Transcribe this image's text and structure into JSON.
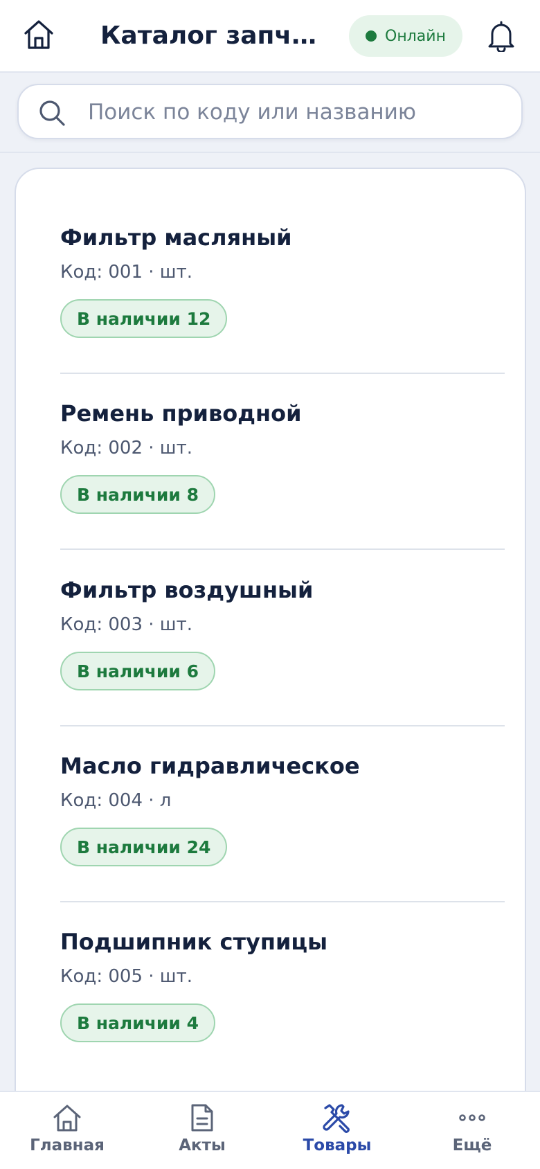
{
  "header": {
    "title": "Каталог запчастей",
    "status": "Онлайн"
  },
  "search": {
    "placeholder": "Поиск по коду или названию",
    "value": ""
  },
  "items": [
    {
      "name": "Фильтр масляный",
      "code": "Код: 001 · шт.",
      "stock": "В наличии 12"
    },
    {
      "name": "Ремень приводной",
      "code": "Код: 002 · шт.",
      "stock": "В наличии 8"
    },
    {
      "name": "Фильтр воздушный",
      "code": "Код: 003 · шт.",
      "stock": "В наличии 6"
    },
    {
      "name": "Масло гидравлическое",
      "code": "Код: 004 · л",
      "stock": "В наличии 24"
    },
    {
      "name": "Подшипник ступицы",
      "code": "Код: 005 · шт.",
      "stock": "В наличии 4"
    }
  ],
  "nav": [
    {
      "label": "Главная",
      "icon": "home-icon",
      "active": false
    },
    {
      "label": "Акты",
      "icon": "document-icon",
      "active": false
    },
    {
      "label": "Товары",
      "icon": "tools-icon",
      "active": true
    },
    {
      "label": "Ещё",
      "icon": "more-icon",
      "active": false
    }
  ],
  "colors": {
    "primary": "#2b4aa8",
    "text": "#14213d",
    "success": "#1d7a3e",
    "success_bg": "#e6f4ea"
  }
}
